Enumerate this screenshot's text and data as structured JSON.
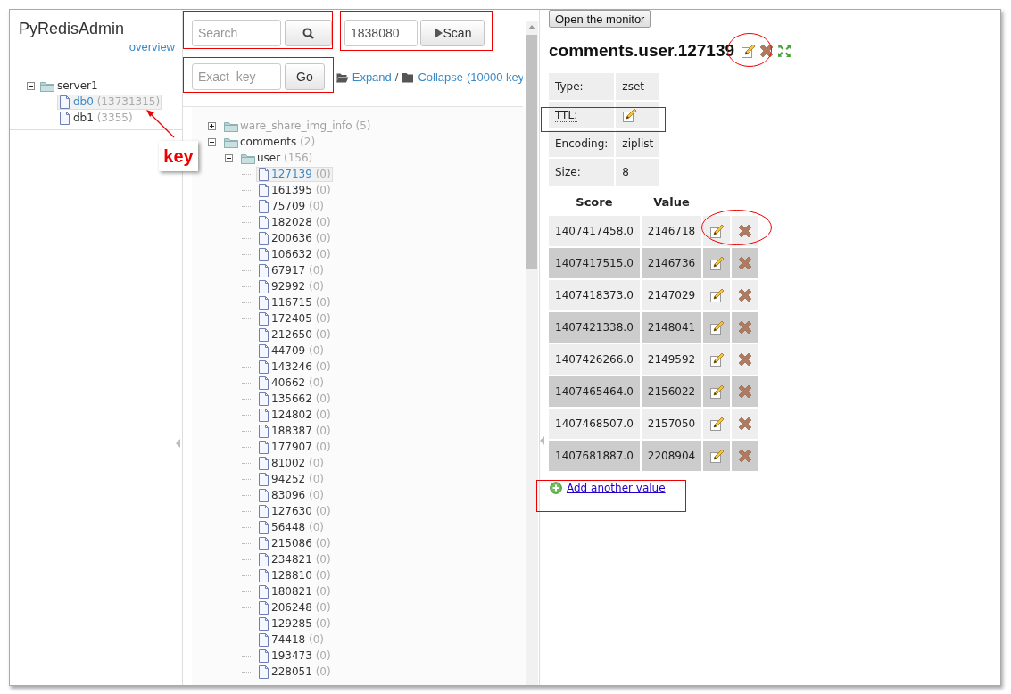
{
  "sidebar": {
    "title": "PyRedisAdmin",
    "overview_link": "overview",
    "tree": [
      {
        "label": "server1",
        "expanded": true,
        "children": [
          {
            "label": "db0",
            "count": "(13731315)",
            "selected": true
          },
          {
            "label": "db1",
            "count": "(3355)",
            "selected": false
          }
        ]
      }
    ]
  },
  "toolbar": {
    "search": {
      "placeholder": "Search"
    },
    "scan": {
      "value": "1838080",
      "button": "Scan"
    },
    "exact_key": {
      "placeholder": "Exact  key",
      "button": "Go"
    },
    "expand_link": "Expand",
    "separator": "/",
    "collapse_link": "Collapse",
    "key_count": "(10000 key"
  },
  "key_tree": [
    {
      "kind": "folder",
      "label": "ware_share_img_info",
      "count": "(5)",
      "expanded": false,
      "dimmed": true
    },
    {
      "kind": "folder",
      "label": "comments",
      "count": "(2)",
      "expanded": true,
      "dimmed": false,
      "children": [
        {
          "kind": "folder",
          "label": "user",
          "count": "(156)",
          "expanded": true,
          "dimmed": false,
          "children": [
            {
              "kind": "key",
              "label": "127139",
              "count": "(0)",
              "selected": true
            },
            {
              "kind": "key",
              "label": "161395",
              "count": "(0)",
              "selected": false
            },
            {
              "kind": "key",
              "label": "75709",
              "count": "(0)",
              "selected": false
            },
            {
              "kind": "key",
              "label": "182028",
              "count": "(0)",
              "selected": false
            },
            {
              "kind": "key",
              "label": "200636",
              "count": "(0)",
              "selected": false
            },
            {
              "kind": "key",
              "label": "106632",
              "count": "(0)",
              "selected": false
            },
            {
              "kind": "key",
              "label": "67917",
              "count": "(0)",
              "selected": false
            },
            {
              "kind": "key",
              "label": "92992",
              "count": "(0)",
              "selected": false
            },
            {
              "kind": "key",
              "label": "116715",
              "count": "(0)",
              "selected": false
            },
            {
              "kind": "key",
              "label": "172405",
              "count": "(0)",
              "selected": false
            },
            {
              "kind": "key",
              "label": "212650",
              "count": "(0)",
              "selected": false
            },
            {
              "kind": "key",
              "label": "44709",
              "count": "(0)",
              "selected": false
            },
            {
              "kind": "key",
              "label": "143246",
              "count": "(0)",
              "selected": false
            },
            {
              "kind": "key",
              "label": "40662",
              "count": "(0)",
              "selected": false
            },
            {
              "kind": "key",
              "label": "135662",
              "count": "(0)",
              "selected": false
            },
            {
              "kind": "key",
              "label": "124802",
              "count": "(0)",
              "selected": false
            },
            {
              "kind": "key",
              "label": "188387",
              "count": "(0)",
              "selected": false
            },
            {
              "kind": "key",
              "label": "177907",
              "count": "(0)",
              "selected": false
            },
            {
              "kind": "key",
              "label": "81002",
              "count": "(0)",
              "selected": false
            },
            {
              "kind": "key",
              "label": "94252",
              "count": "(0)",
              "selected": false
            },
            {
              "kind": "key",
              "label": "83096",
              "count": "(0)",
              "selected": false
            },
            {
              "kind": "key",
              "label": "127630",
              "count": "(0)",
              "selected": false
            },
            {
              "kind": "key",
              "label": "56448",
              "count": "(0)",
              "selected": false
            },
            {
              "kind": "key",
              "label": "215086",
              "count": "(0)",
              "selected": false
            },
            {
              "kind": "key",
              "label": "234821",
              "count": "(0)",
              "selected": false
            },
            {
              "kind": "key",
              "label": "128810",
              "count": "(0)",
              "selected": false
            },
            {
              "kind": "key",
              "label": "180821",
              "count": "(0)",
              "selected": false
            },
            {
              "kind": "key",
              "label": "206248",
              "count": "(0)",
              "selected": false
            },
            {
              "kind": "key",
              "label": "129285",
              "count": "(0)",
              "selected": false
            },
            {
              "kind": "key",
              "label": "74418",
              "count": "(0)",
              "selected": false
            },
            {
              "kind": "key",
              "label": "193473",
              "count": "(0)",
              "selected": false
            },
            {
              "kind": "key",
              "label": "228051",
              "count": "(0)",
              "selected": false
            }
          ]
        }
      ]
    }
  ],
  "detail": {
    "monitor_button": "Open the monitor",
    "title": "comments.user.127139",
    "info": [
      {
        "kind": "text",
        "label": "Type:",
        "value": "zset"
      },
      {
        "kind": "edit",
        "label": "TTL:"
      },
      {
        "kind": "text",
        "label": "Encoding:",
        "value": "ziplist"
      },
      {
        "kind": "text",
        "label": "Size:",
        "value": "8"
      }
    ],
    "columns": [
      "Score",
      "Value"
    ],
    "rows": [
      {
        "score": "1407417458.0",
        "value": "2146718"
      },
      {
        "score": "1407417515.0",
        "value": "2146736"
      },
      {
        "score": "1407418373.0",
        "value": "2147029"
      },
      {
        "score": "1407421338.0",
        "value": "2148041"
      },
      {
        "score": "1407426266.0",
        "value": "2149592"
      },
      {
        "score": "1407465464.0",
        "value": "2156022"
      },
      {
        "score": "1407468507.0",
        "value": "2157050"
      },
      {
        "score": "1407681887.0",
        "value": "2208904"
      }
    ],
    "add_link": "Add another value"
  },
  "annotations": {
    "callout": "key"
  }
}
